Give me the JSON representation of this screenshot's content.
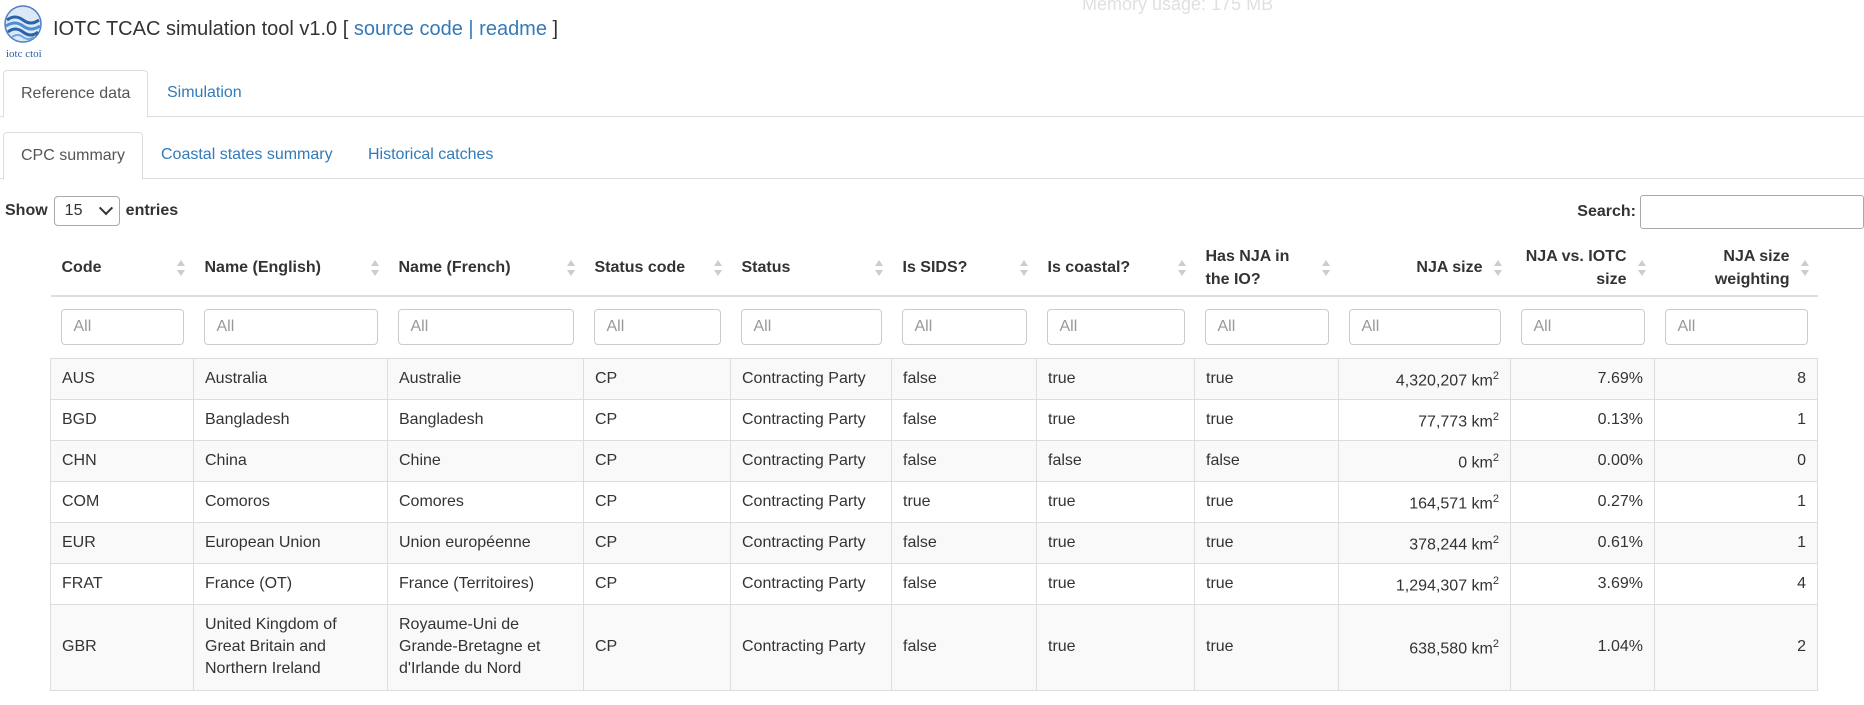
{
  "header": {
    "logo_text": "iotc ctoi",
    "title": "IOTC TCAC simulation tool v1.0",
    "bracket_open": "[",
    "link_source": "source code",
    "separator": "|",
    "link_readme": "readme",
    "bracket_close": "]",
    "background_text": "Memory usage: 175 MB"
  },
  "tabs": [
    {
      "label": "Reference data",
      "active": true
    },
    {
      "label": "Simulation",
      "active": false
    }
  ],
  "subtabs": [
    {
      "label": "CPC summary",
      "active": true
    },
    {
      "label": "Coastal states summary",
      "active": false
    },
    {
      "label": "Historical catches",
      "active": false
    }
  ],
  "controls": {
    "show_label": "Show",
    "entries_value": "15",
    "entries_label": "entries",
    "search_label": "Search:"
  },
  "table": {
    "columns": [
      "Code",
      "Name (English)",
      "Name (French)",
      "Status code",
      "Status",
      "Is SIDS?",
      "Is coastal?",
      "Has NJA in the IO?",
      "NJA size",
      "NJA vs. IOTC size",
      "NJA size weighting"
    ],
    "filter_placeholder": "All",
    "area_unit": "km",
    "area_exp": "2",
    "rows": [
      {
        "code": "AUS",
        "name_en": "Australia",
        "name_fr": "Australie",
        "status_code": "CP",
        "status": "Contracting Party",
        "sids": "false",
        "coastal": "true",
        "nja": "true",
        "nja_size": "4,320,207",
        "nja_pct": "7.69%",
        "weighting": "8"
      },
      {
        "code": "BGD",
        "name_en": "Bangladesh",
        "name_fr": "Bangladesh",
        "status_code": "CP",
        "status": "Contracting Party",
        "sids": "false",
        "coastal": "true",
        "nja": "true",
        "nja_size": "77,773",
        "nja_pct": "0.13%",
        "weighting": "1"
      },
      {
        "code": "CHN",
        "name_en": "China",
        "name_fr": "Chine",
        "status_code": "CP",
        "status": "Contracting Party",
        "sids": "false",
        "coastal": "false",
        "nja": "false",
        "nja_size": "0",
        "nja_pct": "0.00%",
        "weighting": "0"
      },
      {
        "code": "COM",
        "name_en": "Comoros",
        "name_fr": "Comores",
        "status_code": "CP",
        "status": "Contracting Party",
        "sids": "true",
        "coastal": "true",
        "nja": "true",
        "nja_size": "164,571",
        "nja_pct": "0.27%",
        "weighting": "1"
      },
      {
        "code": "EUR",
        "name_en": "European Union",
        "name_fr": "Union européenne",
        "status_code": "CP",
        "status": "Contracting Party",
        "sids": "false",
        "coastal": "true",
        "nja": "true",
        "nja_size": "378,244",
        "nja_pct": "0.61%",
        "weighting": "1"
      },
      {
        "code": "FRAT",
        "name_en": "France (OT)",
        "name_fr": "France (Territoires)",
        "status_code": "CP",
        "status": "Contracting Party",
        "sids": "false",
        "coastal": "true",
        "nja": "true",
        "nja_size": "1,294,307",
        "nja_pct": "3.69%",
        "weighting": "4"
      },
      {
        "code": "GBR",
        "name_en": "United Kingdom of Great Britain and Northern Ireland",
        "name_fr": "Royaume-Uni de Grande-Bretagne et d'Irlande du Nord",
        "status_code": "CP",
        "status": "Contracting Party",
        "sids": "false",
        "coastal": "true",
        "nja": "true",
        "nja_size": "638,580",
        "nja_pct": "1.04%",
        "weighting": "2"
      }
    ]
  }
}
